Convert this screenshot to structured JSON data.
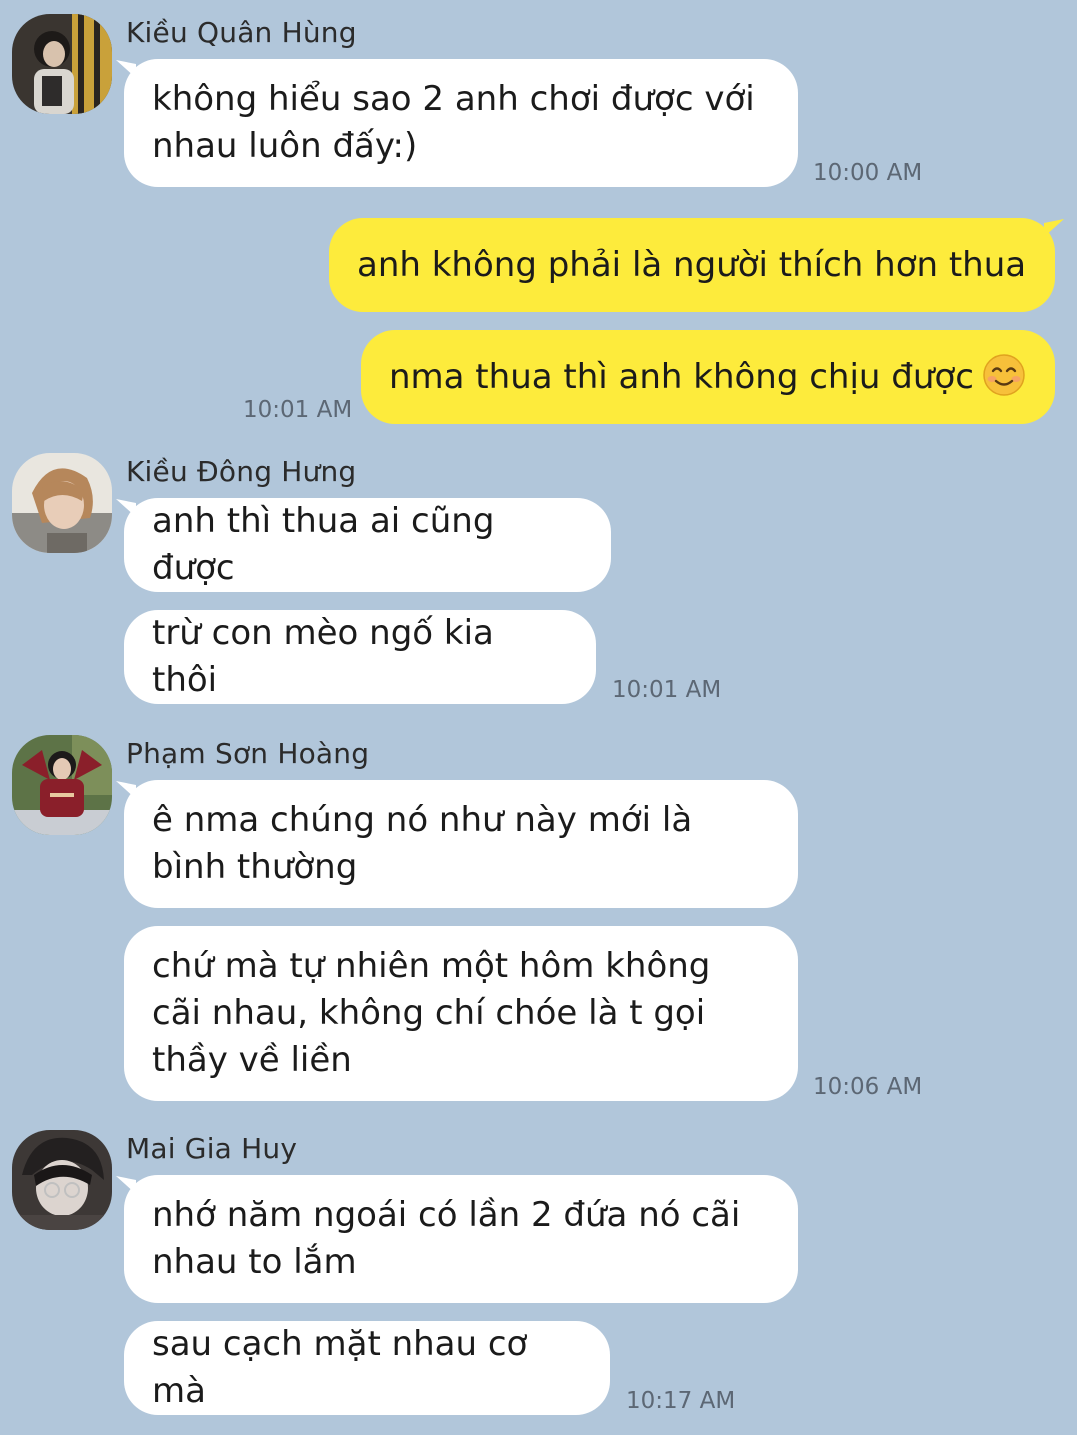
{
  "chat": {
    "messages": [
      {
        "sender": "Kiều Quân Hùng",
        "avatar": "avatar-photo-1",
        "bubbles": [
          "không hiểu sao 2 anh chơi được với nhau luôn đấy:)"
        ],
        "time": "10:00 AM"
      },
      {
        "sender": "me",
        "bubbles": [
          "anh không phải là người thích hơn thua",
          "nma thua thì anh không chịu được"
        ],
        "emoji": "smiling-face-emoji",
        "time": "10:01 AM"
      },
      {
        "sender": "Kiều Đông Hưng",
        "avatar": "avatar-photo-2",
        "bubbles": [
          "anh thì thua ai cũng được",
          "trừ con mèo ngố kia thôi"
        ],
        "time": "10:01 AM"
      },
      {
        "sender": "Phạm Sơn Hoàng",
        "avatar": "avatar-photo-3",
        "bubbles": [
          "ê nma chúng nó như này mới là bình thường",
          "chứ mà tự nhiên một hôm không cãi nhau, không chí chóe là t gọi thầy về liền"
        ],
        "time": "10:06 AM"
      },
      {
        "sender": "Mai Gia Huy",
        "avatar": "avatar-photo-4",
        "bubbles": [
          "nhớ năm ngoái có lần 2 đứa nó cãi nhau to lắm",
          "sau cạch mặt nhau cơ mà"
        ],
        "time": "10:17 AM"
      }
    ]
  },
  "colors": {
    "background": "#b1c6da",
    "incoming_bubble": "#ffffff",
    "outgoing_bubble": "#fdeb3c",
    "timestamp": "#5c6774"
  }
}
